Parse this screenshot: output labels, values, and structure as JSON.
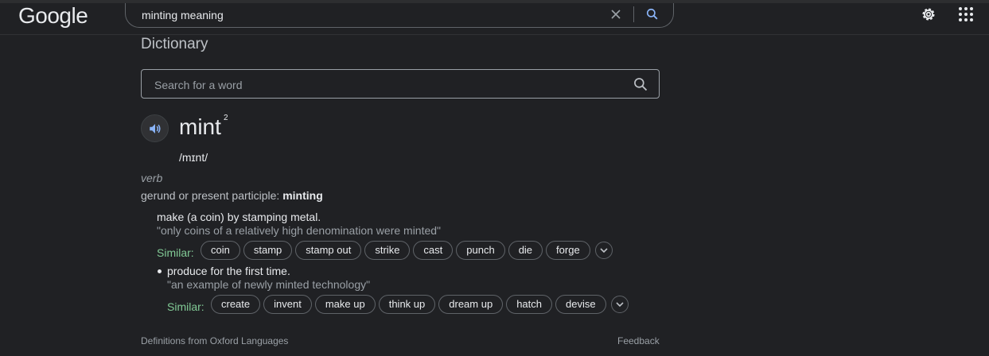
{
  "header": {
    "logo": "Google",
    "query": "minting meaning"
  },
  "dictionary": {
    "title": "Dictionary",
    "search_placeholder": "Search for a word",
    "headword": "mint",
    "homograph": "2",
    "phonetic": "/mɪnt/",
    "part_of_speech": "verb",
    "gerund_label": "gerund or present participle:",
    "gerund_value": "minting",
    "senses": [
      {
        "definition": "make (a coin) by stamping metal.",
        "example": "\"only coins of a relatively high denomination were minted\"",
        "similar_label": "Similar:",
        "similar": [
          "coin",
          "stamp",
          "stamp out",
          "strike",
          "cast",
          "punch",
          "die",
          "forge"
        ]
      },
      {
        "definition": "produce for the first time.",
        "example": "\"an example of newly minted technology\"",
        "similar_label": "Similar:",
        "similar": [
          "create",
          "invent",
          "make up",
          "think up",
          "dream up",
          "hatch",
          "devise"
        ]
      }
    ],
    "source": "Definitions from Oxford Languages",
    "feedback": "Feedback"
  },
  "icons": {
    "clear": "close-icon",
    "search": "search-icon",
    "settings": "gear-icon",
    "apps": "apps-grid-icon",
    "audio": "speaker-icon",
    "expand": "chevron-down-icon"
  },
  "colors": {
    "background": "#202124",
    "similar_label": "#81c995",
    "accent_blue": "#8ab4f8"
  }
}
